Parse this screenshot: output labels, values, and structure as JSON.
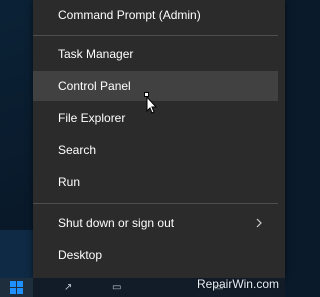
{
  "menu": {
    "items": [
      {
        "id": "command-prompt-admin",
        "label": "Command Prompt (Admin)"
      },
      {
        "id": "task-manager",
        "label": "Task Manager"
      },
      {
        "id": "control-panel",
        "label": "Control Panel"
      },
      {
        "id": "file-explorer",
        "label": "File Explorer"
      },
      {
        "id": "search",
        "label": "Search"
      },
      {
        "id": "run",
        "label": "Run"
      },
      {
        "id": "shut-down",
        "label": "Shut down or sign out"
      },
      {
        "id": "desktop",
        "label": "Desktop"
      }
    ],
    "highlighted_item": "control-panel"
  },
  "watermark": {
    "text": "RepairWin.com"
  },
  "icons": {
    "start": "windows-logo-icon",
    "submenu": "chevron-right-icon",
    "pointer": "mouse-pointer-icon"
  },
  "colors": {
    "menu_bg": "#2b2b2b",
    "highlight_bg": "#414141",
    "text": "#ffffff",
    "start_accent": "#1e90ff"
  }
}
